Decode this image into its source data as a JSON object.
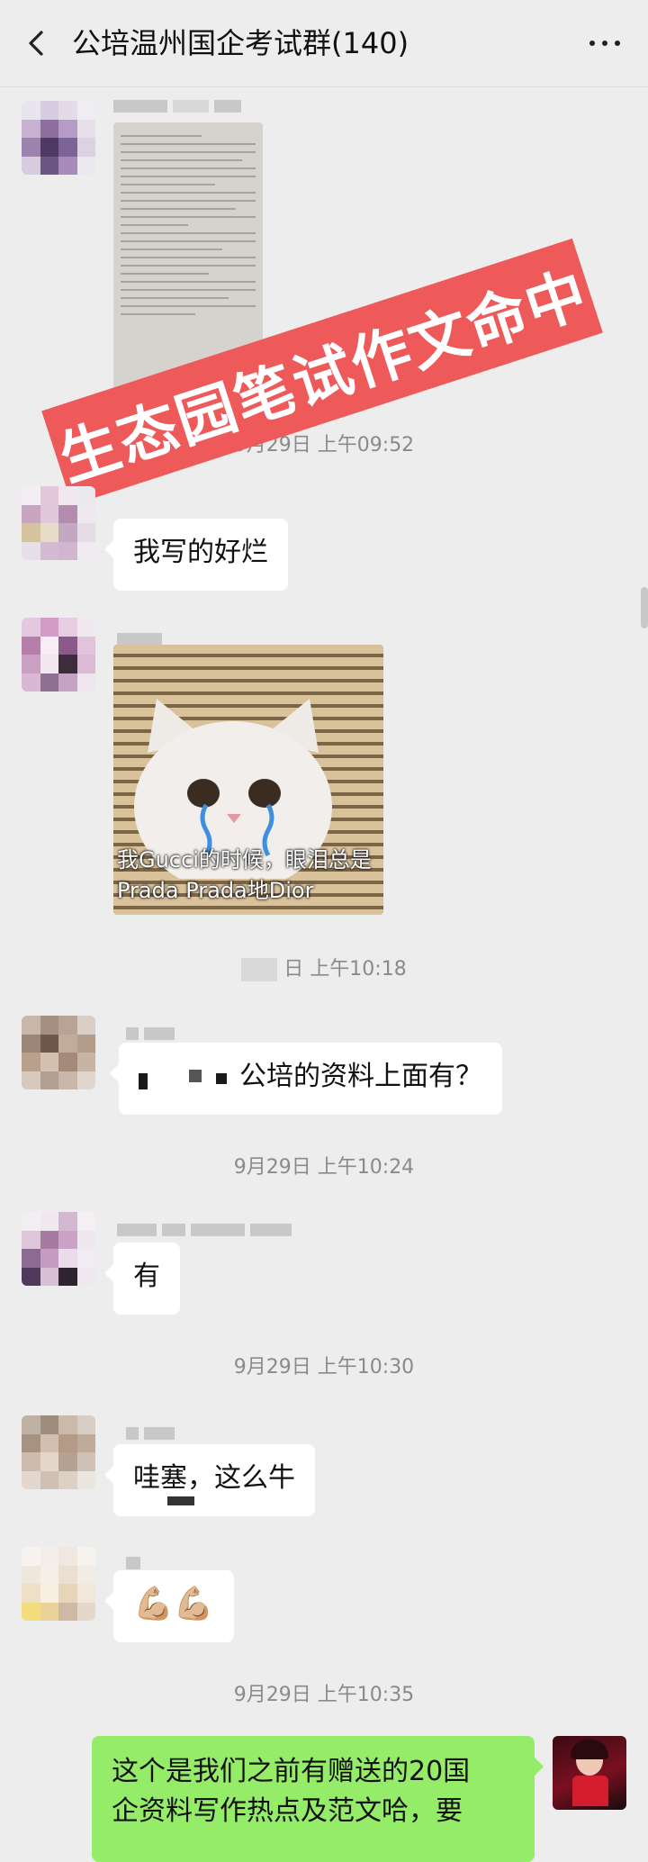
{
  "header": {
    "title": "公培温州国企考试群(140)"
  },
  "overlay_banner": "生态园笔试作文命中",
  "messages": [
    {
      "kind": "image",
      "sender_avatar": "blurred",
      "content": "document-photo"
    },
    {
      "kind": "timestamp",
      "text": "9月29日 上午09:52"
    },
    {
      "kind": "text",
      "text": "我写的好烂"
    },
    {
      "kind": "sticker",
      "caption": "我Gucci的时候，眼泪总是Prada Prada地Dior"
    },
    {
      "kind": "timestamp",
      "text": "日 上午10:18"
    },
    {
      "kind": "text",
      "text": "公培的资料上面有？"
    },
    {
      "kind": "timestamp",
      "text": "9月29日 上午10:24"
    },
    {
      "kind": "text",
      "text": "有"
    },
    {
      "kind": "timestamp",
      "text": "9月29日 上午10:30"
    },
    {
      "kind": "text",
      "text": "哇塞，这么牛"
    },
    {
      "kind": "text",
      "text": "💪🏼💪🏼"
    },
    {
      "kind": "timestamp",
      "text": "9月29日 上午10:35"
    },
    {
      "kind": "text_self",
      "lines": [
        "这个是我们之前有赠送的20国",
        "企资料写作热点及范文哈，要"
      ]
    }
  ],
  "colors": {
    "background": "#ededed",
    "bubble_other": "#ffffff",
    "bubble_self": "#95ec69",
    "banner": "#ee5a5a"
  },
  "icons": [
    "chevron-left-icon",
    "more-dots-icon"
  ]
}
